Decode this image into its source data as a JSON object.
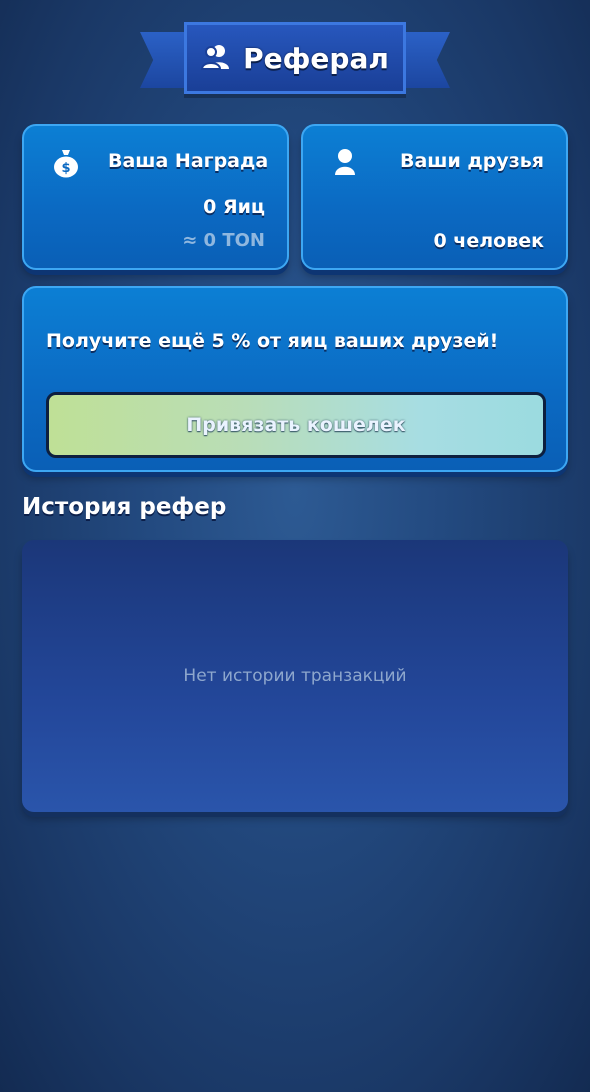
{
  "header": {
    "title": "Реферал",
    "icon": "users-icon"
  },
  "reward_card": {
    "label": "Ваша Награда",
    "value": "0 Яиц",
    "sub_value": "≈ 0 TON",
    "icon": "money-bag-icon"
  },
  "friends_card": {
    "label": "Ваши друзья",
    "value": "0 человек",
    "icon": "user-icon"
  },
  "promo": {
    "text": "Получите ещё 5 % от яиц ваших друзей!",
    "button_label": "Привязать кошелек"
  },
  "history": {
    "title": "История рефер",
    "empty_text": "Нет истории транзакций"
  },
  "colors": {
    "card": "#0b6fc5",
    "card_border": "#3da7f3",
    "panel": "#23479a",
    "ribbon": "#2757bd"
  }
}
